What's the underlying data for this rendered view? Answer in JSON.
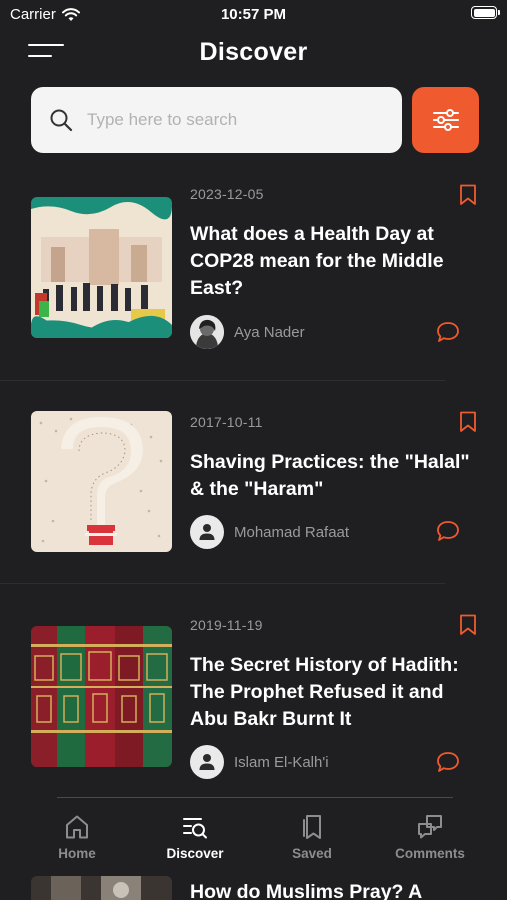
{
  "status_bar": {
    "carrier": "Carrier",
    "time": "10:57 PM"
  },
  "header": {
    "title": "Discover"
  },
  "search": {
    "placeholder": "Type here to search"
  },
  "articles": [
    {
      "date": "2023-12-05",
      "title": "What does a Health Day at COP28 mean for the Middle East?",
      "author": "Aya Nader"
    },
    {
      "date": "2017-10-11",
      "title": "Shaving Practices: the \"Halal\" & the \"Haram\"",
      "author": "Mohamad Rafaat"
    },
    {
      "date": "2019-11-19",
      "title": "The Secret History of Hadith: The Prophet Refused it and Abu Bakr Burnt It",
      "author": "Islam El-Kalh'i"
    },
    {
      "title": "How do Muslims Pray? A"
    }
  ],
  "tabs": [
    {
      "label": "Home",
      "icon": "home-icon"
    },
    {
      "label": "Discover",
      "icon": "discover-icon"
    },
    {
      "label": "Saved",
      "icon": "saved-icon"
    },
    {
      "label": "Comments",
      "icon": "comments-icon"
    }
  ],
  "colors": {
    "background": "#1f1f21",
    "accent": "#ef5a2e",
    "muted_text": "#9a9a9a",
    "search_bg": "#f4f4f4"
  }
}
